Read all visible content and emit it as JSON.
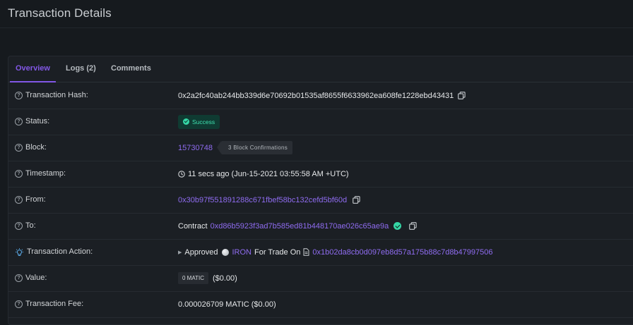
{
  "page": {
    "title": "Transaction Details"
  },
  "tabs": [
    {
      "label": "Overview",
      "active": true
    },
    {
      "label": "Logs (2)",
      "active": false
    },
    {
      "label": "Comments",
      "active": false
    }
  ],
  "rows": {
    "hash": {
      "label": "Transaction Hash:",
      "value": "0x2a2fc40ab244bb339d6e70692b01535af8655f6633962ea608fe1228ebd43431"
    },
    "status": {
      "label": "Status:",
      "value": "Success"
    },
    "block": {
      "label": "Block:",
      "value": "15730748",
      "confirmations": "3 Block Confirmations"
    },
    "timestamp": {
      "label": "Timestamp:",
      "value": "11 secs ago (Jun-15-2021 03:55:58 AM +UTC)"
    },
    "from": {
      "label": "From:",
      "value": "0x30b97f551891288c671fbef58bc132cefd5bf60d"
    },
    "to": {
      "label": "To:",
      "prefix": "Contract",
      "value": "0xd86b5923f3ad7b585ed81b448170ae026c65ae9a"
    },
    "action": {
      "label": "Transaction Action:",
      "verb": "Approved",
      "token": "IRON",
      "middle": "For Trade On",
      "address": "0x1b02da8cb0d097eb8d57a175b88c7d8b47997506"
    },
    "value": {
      "label": "Value:",
      "amount": "0 MATIC",
      "usd": "($0.00)"
    },
    "fee": {
      "label": "Transaction Fee:",
      "value": "0.000026709 MATIC ($0.00)"
    }
  },
  "colors": {
    "accent": "#8257e6",
    "success": "#35d7a6",
    "background": "#161a1e"
  }
}
